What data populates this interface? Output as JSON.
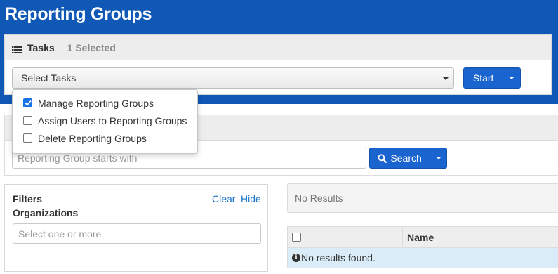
{
  "page": {
    "title": "Reporting Groups"
  },
  "tasks": {
    "label": "Tasks",
    "selected_count": "1 Selected",
    "select_placeholder": "Select Tasks",
    "start_label": "Start",
    "menu_items": [
      {
        "label": "Manage Reporting Groups",
        "checked": true
      },
      {
        "label": "Assign Users to Reporting Groups",
        "checked": false
      },
      {
        "label": "Delete Reporting Groups",
        "checked": false
      }
    ]
  },
  "search": {
    "placeholder": "Reporting Group starts with",
    "button_label": "Search"
  },
  "filters": {
    "title": "Filters",
    "clear_label": "Clear",
    "hide_label": "Hide",
    "organizations_label": "Organizations",
    "organizations_placeholder": "Select one or more"
  },
  "results": {
    "status": "No Results",
    "columns": [
      "",
      "Name"
    ],
    "empty_message": "No results found."
  },
  "colors": {
    "header": "#1058b5",
    "primary_button": "#1a64cf",
    "link": "#1a73c9",
    "info_row": "#d9ecf7"
  }
}
